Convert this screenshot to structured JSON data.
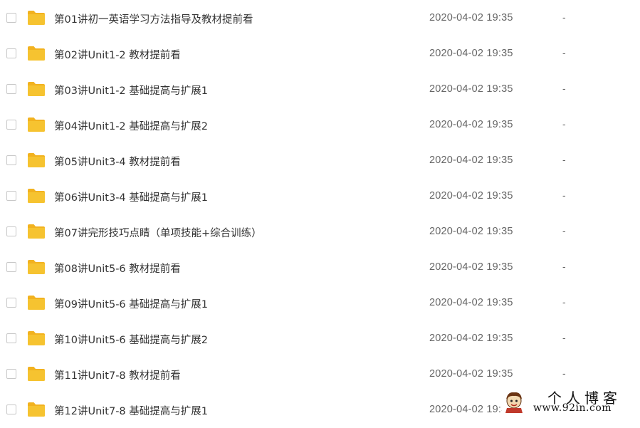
{
  "files": [
    {
      "name": "第01讲初一英语学习方法指导及教材提前看",
      "modified": "2020-04-02 19:35",
      "size": "-"
    },
    {
      "name": "第02讲Unit1-2 教材提前看",
      "modified": "2020-04-02 19:35",
      "size": "-"
    },
    {
      "name": "第03讲Unit1-2 基础提高与扩展1",
      "modified": "2020-04-02 19:35",
      "size": "-"
    },
    {
      "name": "第04讲Unit1-2 基础提高与扩展2",
      "modified": "2020-04-02 19:35",
      "size": "-"
    },
    {
      "name": "第05讲Unit3-4 教材提前看",
      "modified": "2020-04-02 19:35",
      "size": "-"
    },
    {
      "name": "第06讲Unit3-4 基础提高与扩展1",
      "modified": "2020-04-02 19:35",
      "size": "-"
    },
    {
      "name": "第07讲完形技巧点睛（单项技能+综合训练）",
      "modified": "2020-04-02 19:35",
      "size": "-"
    },
    {
      "name": "第08讲Unit5-6 教材提前看",
      "modified": "2020-04-02 19:35",
      "size": "-"
    },
    {
      "name": "第09讲Unit5-6 基础提高与扩展1",
      "modified": "2020-04-02 19:35",
      "size": "-"
    },
    {
      "name": "第10讲Unit5-6 基础提高与扩展2",
      "modified": "2020-04-02 19:35",
      "size": "-"
    },
    {
      "name": "第11讲Unit7-8 教材提前看",
      "modified": "2020-04-02 19:35",
      "size": "-"
    },
    {
      "name": "第12讲Unit7-8 基础提高与扩展1",
      "modified": "2020-04-02 19:35",
      "size": "-"
    }
  ],
  "watermark": {
    "title": "个人博客",
    "url": "www.92in.com"
  },
  "colors": {
    "folder": "#f6c330",
    "folder_tab": "#f2b21f"
  }
}
